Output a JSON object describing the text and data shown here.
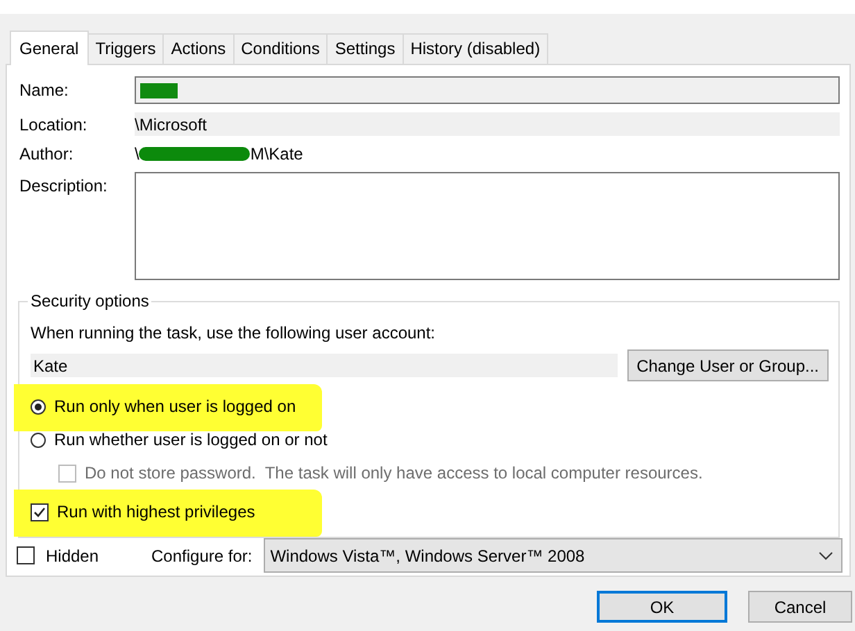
{
  "tabs": [
    {
      "label": "General",
      "selected": true
    },
    {
      "label": "Triggers",
      "selected": false
    },
    {
      "label": "Actions",
      "selected": false
    },
    {
      "label": "Conditions",
      "selected": false
    },
    {
      "label": "Settings",
      "selected": false
    },
    {
      "label": "History (disabled)",
      "selected": false
    }
  ],
  "fields": {
    "name_label": "Name:",
    "location_label": "Location:",
    "location": "\\Microsoft",
    "author_label": "Author:",
    "author_prefix": "\\",
    "author_suffix": "M\\Kate",
    "description_label": "Description:"
  },
  "security": {
    "title": "Security options",
    "prompt": "When running the task, use the following user account:",
    "user_account": "Kate",
    "change_button": "Change User or Group...",
    "options": [
      {
        "kind": "radio",
        "label": "Run only when user is logged on",
        "selected": true,
        "highlighted": true
      },
      {
        "kind": "radio",
        "label": "Run whether user is logged on or not",
        "selected": false,
        "highlighted": false,
        "children": [
          {
            "kind": "checkbox",
            "label": "Do not store password.  The task will only have access to local computer resources.",
            "checked": false,
            "disabled": true,
            "highlighted": false
          }
        ]
      },
      {
        "kind": "checkbox",
        "label": "Run with highest privileges",
        "checked": true,
        "disabled": false,
        "highlighted": true
      }
    ]
  },
  "hidden": {
    "label": "Hidden",
    "checked": false
  },
  "configure": {
    "label": "Configure for:",
    "value": "Windows Vista™, Windows Server™ 2008"
  },
  "buttons": [
    {
      "label": "OK",
      "default": true
    },
    {
      "label": "Cancel",
      "default": false
    }
  ]
}
